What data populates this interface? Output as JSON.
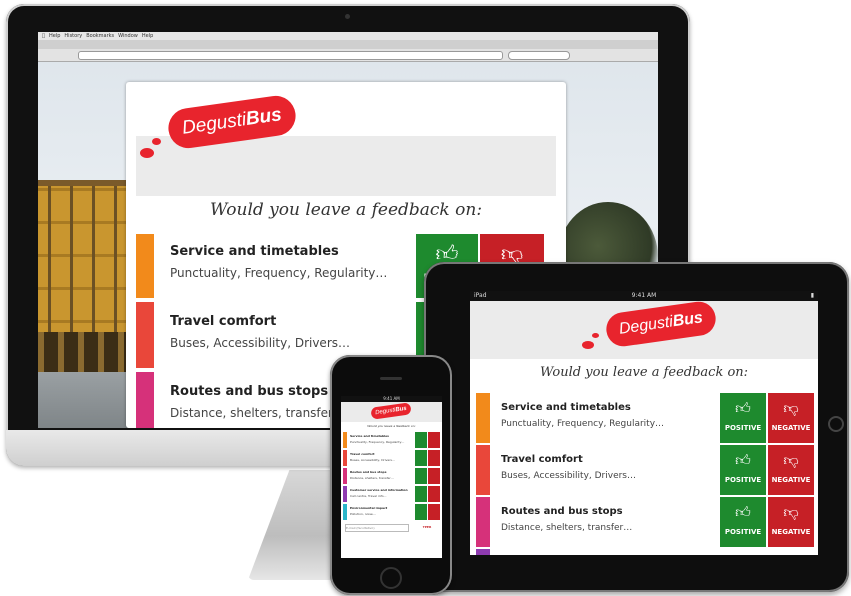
{
  "brand": {
    "logo_prefix": "Degusti",
    "logo_bold": "Bus",
    "red": "#e8242d",
    "positive_green": "#1e8a2e",
    "negative_red": "#c62026"
  },
  "prompt": "Would you leave a feedback on:",
  "categories": [
    {
      "title": "Service and timetables",
      "subtitle": "Punctuality, Frequency, Regularity…",
      "color": "#f28a1b"
    },
    {
      "title": "Travel comfort",
      "subtitle": "Buses, Accessibility, Drivers…",
      "color": "#e9473a"
    },
    {
      "title": "Routes and bus stops",
      "subtitle": "Distance, shelters, transfer…",
      "color": "#d6317a"
    },
    {
      "title": "Customer service and information",
      "subtitle": "Call centre, Travel info…",
      "color": "#8e3bb0"
    },
    {
      "title": "Environmental impact",
      "subtitle": "Pollution, noise…",
      "color": "#2bb5c9"
    }
  ],
  "buttons": {
    "positive": "POSITIVE",
    "negative": "NEGATIVE"
  },
  "tablet_status": {
    "carrier": "iPad",
    "time": "9:41 AM"
  },
  "phone_status": {
    "time": "9:41 AM"
  },
  "phone_footer": {
    "placeholder": "E-mail (facoltativo)",
    "badge": "TPER"
  }
}
